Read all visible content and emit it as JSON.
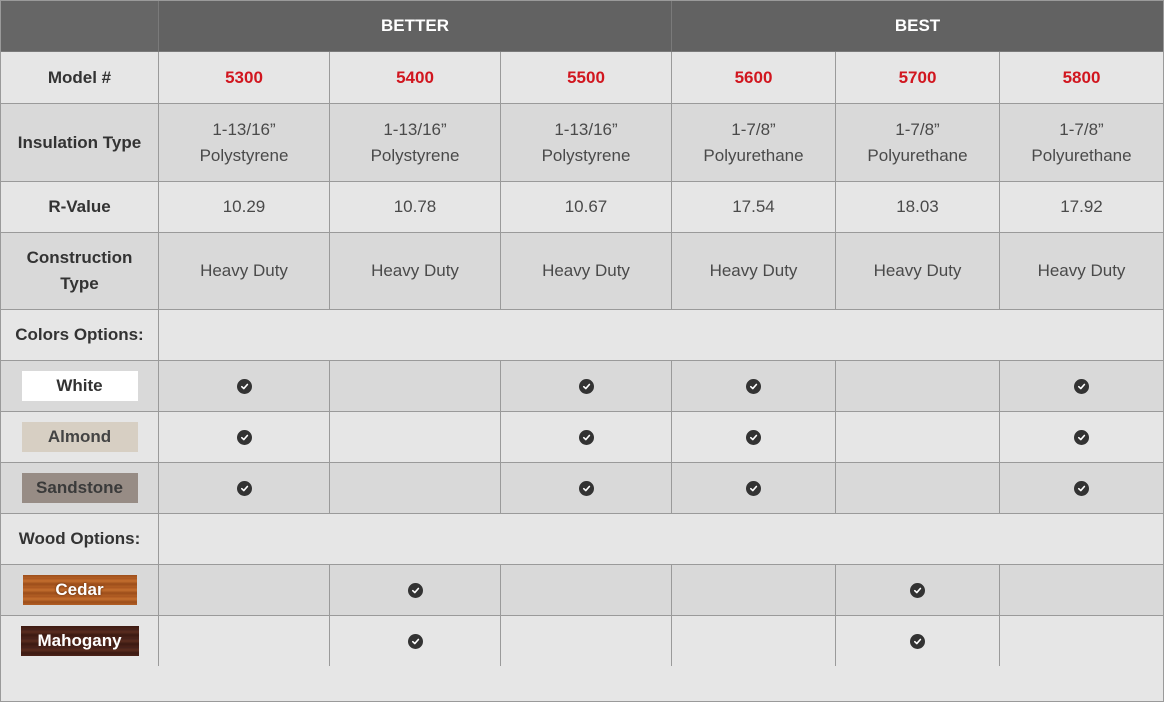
{
  "header": {
    "groups": [
      "BETTER",
      "BEST"
    ]
  },
  "models": {
    "label": "Model #",
    "values": [
      "5300",
      "5400",
      "5500",
      "5600",
      "5700",
      "5800"
    ]
  },
  "insulation": {
    "label": "Insulation Type",
    "values": [
      [
        "1-13/16”",
        "Polystyrene"
      ],
      [
        "1-13/16”",
        "Polystyrene"
      ],
      [
        "1-13/16”",
        "Polystyrene"
      ],
      [
        "1-7/8”",
        "Polyurethane"
      ],
      [
        "1-7/8”",
        "Polyurethane"
      ],
      [
        "1-7/8”",
        "Polyurethane"
      ]
    ]
  },
  "rvalue": {
    "label": "R-Value",
    "values": [
      "10.29",
      "10.78",
      "10.67",
      "17.54",
      "18.03",
      "17.92"
    ]
  },
  "construction": {
    "label_line1": "Construction",
    "label_line2": "Type",
    "values": [
      "Heavy Duty",
      "Heavy Duty",
      "Heavy Duty",
      "Heavy Duty",
      "Heavy Duty",
      "Heavy Duty"
    ]
  },
  "colors": {
    "section_label": "Colors Options:",
    "options": [
      {
        "name": "White",
        "swatch": "#ffffff",
        "available": [
          true,
          false,
          true,
          true,
          false,
          true
        ]
      },
      {
        "name": "Almond",
        "swatch": "#d7cfc3",
        "available": [
          true,
          false,
          true,
          true,
          false,
          true
        ]
      },
      {
        "name": "Sandstone",
        "swatch": "#978c85",
        "available": [
          true,
          false,
          true,
          true,
          false,
          true
        ]
      }
    ]
  },
  "wood": {
    "section_label": "Wood Options:",
    "options": [
      {
        "name": "Cedar",
        "swatch": "#b25e24",
        "available": [
          false,
          true,
          false,
          false,
          true,
          false
        ]
      },
      {
        "name": "Mahogany",
        "swatch": "#4a2218",
        "available": [
          false,
          true,
          false,
          false,
          true,
          false
        ]
      }
    ]
  },
  "icons": {
    "check": "check-circle-icon"
  },
  "theme": {
    "header_bg": "#626262",
    "model_color": "#d1161f"
  }
}
